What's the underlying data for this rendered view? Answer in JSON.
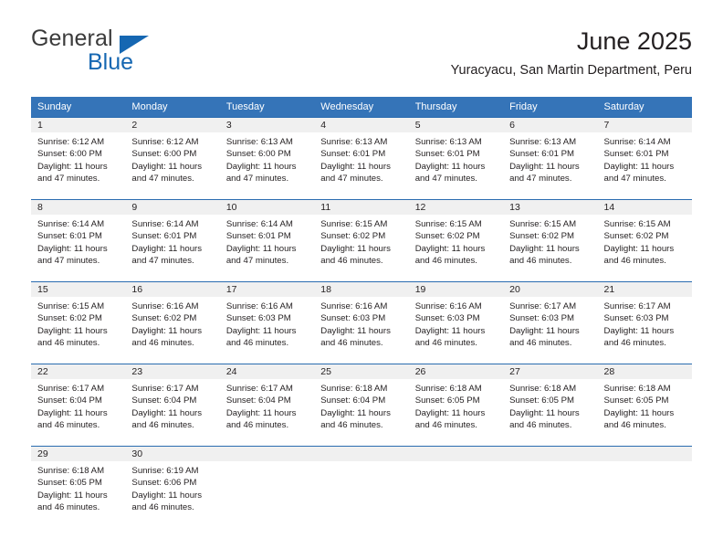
{
  "brand": {
    "name_part1": "General",
    "name_part2": "Blue",
    "colors": {
      "blue": "#1567b2",
      "dark": "#3b3b3b"
    }
  },
  "header": {
    "title": "June 2025",
    "subtitle": "Yuracyacu, San Martin Department, Peru"
  },
  "theme": {
    "header_blue": "#3574b8",
    "row_divider_blue": "#2a6cb0",
    "daynum_band": "#f0f0f0",
    "text": "#231f20"
  },
  "calendar": {
    "weekday_headers": [
      "Sunday",
      "Monday",
      "Tuesday",
      "Wednesday",
      "Thursday",
      "Friday",
      "Saturday"
    ],
    "weeks": [
      [
        {
          "day": "1",
          "sunrise": "Sunrise: 6:12 AM",
          "sunset": "Sunset: 6:00 PM",
          "daylight": "Daylight: 11 hours and 47 minutes."
        },
        {
          "day": "2",
          "sunrise": "Sunrise: 6:12 AM",
          "sunset": "Sunset: 6:00 PM",
          "daylight": "Daylight: 11 hours and 47 minutes."
        },
        {
          "day": "3",
          "sunrise": "Sunrise: 6:13 AM",
          "sunset": "Sunset: 6:00 PM",
          "daylight": "Daylight: 11 hours and 47 minutes."
        },
        {
          "day": "4",
          "sunrise": "Sunrise: 6:13 AM",
          "sunset": "Sunset: 6:01 PM",
          "daylight": "Daylight: 11 hours and 47 minutes."
        },
        {
          "day": "5",
          "sunrise": "Sunrise: 6:13 AM",
          "sunset": "Sunset: 6:01 PM",
          "daylight": "Daylight: 11 hours and 47 minutes."
        },
        {
          "day": "6",
          "sunrise": "Sunrise: 6:13 AM",
          "sunset": "Sunset: 6:01 PM",
          "daylight": "Daylight: 11 hours and 47 minutes."
        },
        {
          "day": "7",
          "sunrise": "Sunrise: 6:14 AM",
          "sunset": "Sunset: 6:01 PM",
          "daylight": "Daylight: 11 hours and 47 minutes."
        }
      ],
      [
        {
          "day": "8",
          "sunrise": "Sunrise: 6:14 AM",
          "sunset": "Sunset: 6:01 PM",
          "daylight": "Daylight: 11 hours and 47 minutes."
        },
        {
          "day": "9",
          "sunrise": "Sunrise: 6:14 AM",
          "sunset": "Sunset: 6:01 PM",
          "daylight": "Daylight: 11 hours and 47 minutes."
        },
        {
          "day": "10",
          "sunrise": "Sunrise: 6:14 AM",
          "sunset": "Sunset: 6:01 PM",
          "daylight": "Daylight: 11 hours and 47 minutes."
        },
        {
          "day": "11",
          "sunrise": "Sunrise: 6:15 AM",
          "sunset": "Sunset: 6:02 PM",
          "daylight": "Daylight: 11 hours and 46 minutes."
        },
        {
          "day": "12",
          "sunrise": "Sunrise: 6:15 AM",
          "sunset": "Sunset: 6:02 PM",
          "daylight": "Daylight: 11 hours and 46 minutes."
        },
        {
          "day": "13",
          "sunrise": "Sunrise: 6:15 AM",
          "sunset": "Sunset: 6:02 PM",
          "daylight": "Daylight: 11 hours and 46 minutes."
        },
        {
          "day": "14",
          "sunrise": "Sunrise: 6:15 AM",
          "sunset": "Sunset: 6:02 PM",
          "daylight": "Daylight: 11 hours and 46 minutes."
        }
      ],
      [
        {
          "day": "15",
          "sunrise": "Sunrise: 6:15 AM",
          "sunset": "Sunset: 6:02 PM",
          "daylight": "Daylight: 11 hours and 46 minutes."
        },
        {
          "day": "16",
          "sunrise": "Sunrise: 6:16 AM",
          "sunset": "Sunset: 6:02 PM",
          "daylight": "Daylight: 11 hours and 46 minutes."
        },
        {
          "day": "17",
          "sunrise": "Sunrise: 6:16 AM",
          "sunset": "Sunset: 6:03 PM",
          "daylight": "Daylight: 11 hours and 46 minutes."
        },
        {
          "day": "18",
          "sunrise": "Sunrise: 6:16 AM",
          "sunset": "Sunset: 6:03 PM",
          "daylight": "Daylight: 11 hours and 46 minutes."
        },
        {
          "day": "19",
          "sunrise": "Sunrise: 6:16 AM",
          "sunset": "Sunset: 6:03 PM",
          "daylight": "Daylight: 11 hours and 46 minutes."
        },
        {
          "day": "20",
          "sunrise": "Sunrise: 6:17 AM",
          "sunset": "Sunset: 6:03 PM",
          "daylight": "Daylight: 11 hours and 46 minutes."
        },
        {
          "day": "21",
          "sunrise": "Sunrise: 6:17 AM",
          "sunset": "Sunset: 6:03 PM",
          "daylight": "Daylight: 11 hours and 46 minutes."
        }
      ],
      [
        {
          "day": "22",
          "sunrise": "Sunrise: 6:17 AM",
          "sunset": "Sunset: 6:04 PM",
          "daylight": "Daylight: 11 hours and 46 minutes."
        },
        {
          "day": "23",
          "sunrise": "Sunrise: 6:17 AM",
          "sunset": "Sunset: 6:04 PM",
          "daylight": "Daylight: 11 hours and 46 minutes."
        },
        {
          "day": "24",
          "sunrise": "Sunrise: 6:17 AM",
          "sunset": "Sunset: 6:04 PM",
          "daylight": "Daylight: 11 hours and 46 minutes."
        },
        {
          "day": "25",
          "sunrise": "Sunrise: 6:18 AM",
          "sunset": "Sunset: 6:04 PM",
          "daylight": "Daylight: 11 hours and 46 minutes."
        },
        {
          "day": "26",
          "sunrise": "Sunrise: 6:18 AM",
          "sunset": "Sunset: 6:05 PM",
          "daylight": "Daylight: 11 hours and 46 minutes."
        },
        {
          "day": "27",
          "sunrise": "Sunrise: 6:18 AM",
          "sunset": "Sunset: 6:05 PM",
          "daylight": "Daylight: 11 hours and 46 minutes."
        },
        {
          "day": "28",
          "sunrise": "Sunrise: 6:18 AM",
          "sunset": "Sunset: 6:05 PM",
          "daylight": "Daylight: 11 hours and 46 minutes."
        }
      ],
      [
        {
          "day": "29",
          "sunrise": "Sunrise: 6:18 AM",
          "sunset": "Sunset: 6:05 PM",
          "daylight": "Daylight: 11 hours and 46 minutes."
        },
        {
          "day": "30",
          "sunrise": "Sunrise: 6:19 AM",
          "sunset": "Sunset: 6:06 PM",
          "daylight": "Daylight: 11 hours and 46 minutes."
        },
        {
          "day": "",
          "sunrise": "",
          "sunset": "",
          "daylight": ""
        },
        {
          "day": "",
          "sunrise": "",
          "sunset": "",
          "daylight": ""
        },
        {
          "day": "",
          "sunrise": "",
          "sunset": "",
          "daylight": ""
        },
        {
          "day": "",
          "sunrise": "",
          "sunset": "",
          "daylight": ""
        },
        {
          "day": "",
          "sunrise": "",
          "sunset": "",
          "daylight": ""
        }
      ]
    ]
  }
}
